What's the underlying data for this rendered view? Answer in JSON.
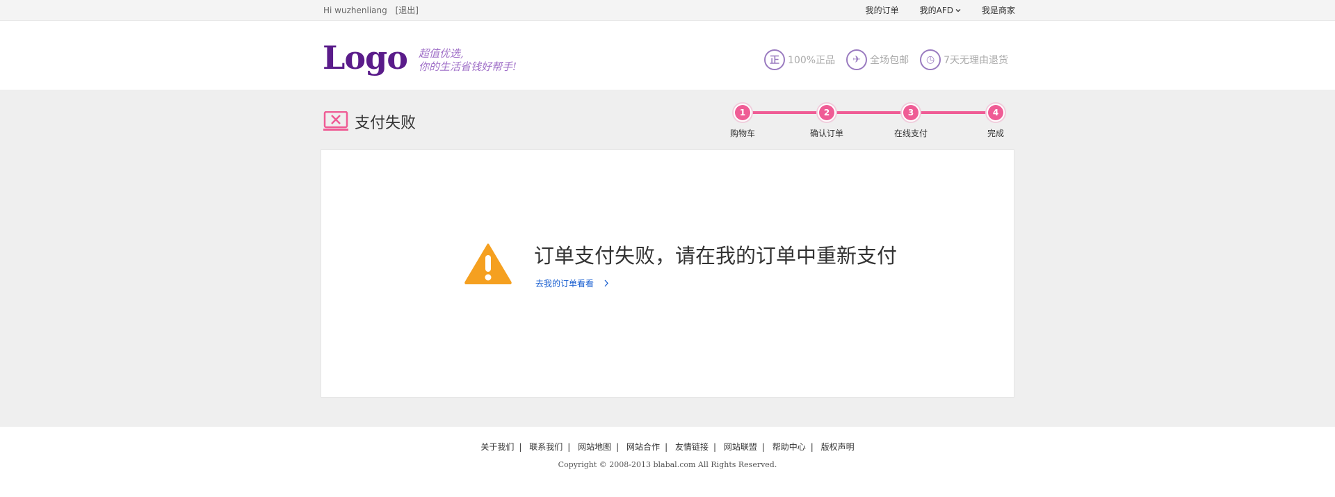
{
  "topbar": {
    "greeting": "Hi wuzhenliang",
    "logout": "[退出]",
    "links": [
      "我的订单",
      "我的AFD",
      "我是商家"
    ]
  },
  "header": {
    "logo": "Logo",
    "slogan_line1": "超值优选,",
    "slogan_line2": "你的生活省钱好帮手!",
    "promises": [
      {
        "icon": "genuine-icon",
        "glyph": "正",
        "label": "100%正品"
      },
      {
        "icon": "free-shipping-icon",
        "glyph": "✈",
        "label": "全场包邮"
      },
      {
        "icon": "clock-icon",
        "glyph": "◷",
        "label": "7天无理由退货"
      }
    ]
  },
  "page": {
    "title": "支付失败"
  },
  "steps": [
    {
      "num": "1",
      "label": "购物车"
    },
    {
      "num": "2",
      "label": "确认订单"
    },
    {
      "num": "3",
      "label": "在线支付"
    },
    {
      "num": "4",
      "label": "完成"
    }
  ],
  "result": {
    "message": "订单支付失败，请在我的订单中重新支付",
    "link": "去我的订单看看"
  },
  "footer": {
    "links": [
      "关于我们",
      "联系我们",
      "网站地图",
      "网站合作",
      "友情链接",
      "网站联盟",
      "帮助中心",
      "版权声明"
    ],
    "copyright": "Copyright © 2008-2013 blabal.com All Rights Reserved."
  },
  "colors": {
    "brand": "#5a1c8a",
    "accent": "#ef5c95",
    "link": "#1a5fd0",
    "warning": "#f5a020"
  }
}
